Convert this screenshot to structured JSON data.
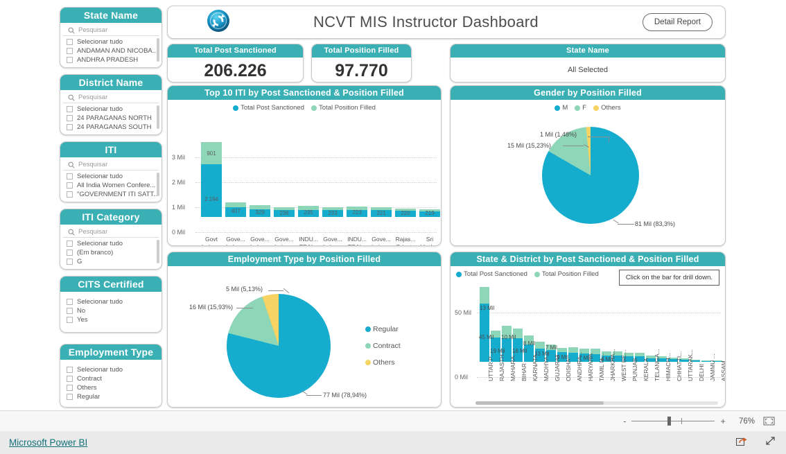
{
  "colors": {
    "teal_header": "#3aafb4",
    "series_sanctioned": "#16accd",
    "series_filled": "#8ed6b8",
    "others_yellow": "#f7d364",
    "link": "#10707a"
  },
  "header": {
    "logo_icon": "sync-circle-logo",
    "title": "NCVT MIS Instructor Dashboard",
    "detail_report_label": "Detail Report"
  },
  "kpis": [
    {
      "title": "Total Post Sanctioned",
      "value": "206.226"
    },
    {
      "title": "Total Position Filled",
      "value": "97.770"
    }
  ],
  "state_card": {
    "title": "State Name",
    "value": "All Selected"
  },
  "slicers": [
    {
      "title": "State Name",
      "search_placeholder": "Pesquisar",
      "options": [
        "Selecionar tudo",
        "ANDAMAN AND NICOBA...",
        "ANDHRA PRADESH"
      ],
      "has_search": true,
      "has_scrollbar": true
    },
    {
      "title": "District Name",
      "search_placeholder": "Pesquisar",
      "options": [
        "Selecionar tudo",
        "24 PARAGANAS NORTH",
        "24 PARAGANAS SOUTH"
      ],
      "has_search": true,
      "has_scrollbar": true
    },
    {
      "title": "ITI",
      "search_placeholder": "Pesquisar",
      "options": [
        "Selecionar tudo",
        "All India Women Confere...",
        "\"GOVERNMENT ITI SATT..."
      ],
      "has_search": true,
      "has_scrollbar": true
    },
    {
      "title": "ITI Category",
      "search_placeholder": "Pesquisar",
      "options": [
        "Selecionar tudo",
        "(Em branco)",
        "G"
      ],
      "has_search": true,
      "has_scrollbar": true
    },
    {
      "title": "CITS Certified",
      "search_placeholder": "",
      "options": [
        "Selecionar tudo",
        "No",
        "Yes"
      ],
      "has_search": false,
      "has_scrollbar": false
    },
    {
      "title": "Employment Type",
      "search_placeholder": "",
      "options": [
        "Selecionar tudo",
        "Contract",
        "Others",
        "Regular"
      ],
      "has_search": false,
      "has_scrollbar": false
    }
  ],
  "visuals": {
    "top10": {
      "title": "Top 10 ITI by Post Sanctioned & Position Filled"
    },
    "gender": {
      "title": "Gender by Position Filled"
    },
    "employment": {
      "title": "Employment Type by Position Filled"
    },
    "state_district": {
      "title": "State & District by Post Sanctioned & Position Filled",
      "drill_note": "Click on the bar for drill down."
    }
  },
  "statusbar": {
    "minus": "-",
    "plus": "+",
    "zoom_level": "76%",
    "fit_icon": "fit-to-page-icon"
  },
  "footer": {
    "link_label": "Microsoft Power BI",
    "share_icon": "share-icon",
    "fullscreen_icon": "fullscreen-icon"
  },
  "chart_data": [
    {
      "id": "top10",
      "type": "bar",
      "stacked": true,
      "title": "Top 10 ITI by Post Sanctioned & Position Filled",
      "xlabel": "",
      "ylabel": "",
      "ylim": [
        0,
        3000000
      ],
      "ytick_labels": [
        "0 Mil",
        "1 Mil",
        "2 Mil",
        "3 Mil"
      ],
      "grid": true,
      "legend_position": "top",
      "legend": [
        "Total Post Sanctioned",
        "Total Position Filled"
      ],
      "categories": [
        "Govt Indus... Traini...",
        "Gove... Indus... Traini...",
        "Gove... Indus... Traini...",
        "Gove... Indus... Traini...",
        "INDU... TRAI... INSTI...",
        "Gove... Indus... Traini...",
        "INDU... TRAI... INSTI...",
        "Gove... Indus... Traini...",
        "Rajas... Private Indus...",
        "Sri Venk... Indus..."
      ],
      "series": [
        {
          "name": "Total Post Sanctioned",
          "values": [
            2194,
            407,
            329,
            236,
            235,
            233,
            223,
            221,
            220,
            219
          ]
        },
        {
          "name": "Total Position Filled",
          "values": [
            901,
            150,
            110,
            85,
            130,
            80,
            90,
            80,
            55,
            48
          ]
        }
      ],
      "bar_data_labels": [
        "2.194",
        "407",
        "329",
        "236",
        "235",
        "233",
        "223",
        "221",
        "220",
        "219"
      ],
      "top_segment_label": "901"
    },
    {
      "id": "gender",
      "type": "pie",
      "title": "Gender by Position Filled",
      "legend_position": "top",
      "labels": [
        "M",
        "F",
        "Others"
      ],
      "values": [
        83.3,
        15.23,
        1.48
      ],
      "slice_labels": [
        "81 Mil (83,3%)",
        "15 Mil (15,23%)",
        "1 Mil (1,48%)"
      ],
      "slice_colors": [
        "#16accd",
        "#8ed6b8",
        "#f7d364"
      ]
    },
    {
      "id": "employment",
      "type": "pie",
      "title": "Employment Type by Position Filled",
      "legend_position": "right",
      "labels": [
        "Regular",
        "Contract",
        "Others"
      ],
      "values": [
        78.94,
        15.93,
        5.13
      ],
      "slice_labels": [
        "77 Mil (78,94%)",
        "16 Mil (15,93%)",
        "5 Mil (5,13%)"
      ],
      "slice_colors": [
        "#16accd",
        "#8ed6b8",
        "#f7d364"
      ]
    },
    {
      "id": "state_district",
      "type": "bar",
      "stacked": true,
      "title": "State & District by Post Sanctioned & Position Filled",
      "ylim": [
        0,
        60
      ],
      "ytick_labels": [
        "0 Mil",
        "50 Mil"
      ],
      "grid": true,
      "legend_position": "top",
      "legend": [
        "Total Post Sanctioned",
        "Total Position Filled"
      ],
      "categories": [
        "UTTAR P...",
        "RAJASTH...",
        "MAHARA...",
        "BIHAR",
        "KARNATA...",
        "MADHYA...",
        "GUJARAT",
        "ODISHA",
        "ANDHRA...",
        "HARYANA",
        "TAMIL N...",
        "JHARKHA...",
        "WEST BE...",
        "PUNJAB",
        "KERALA",
        "TELANGA...",
        "HIMACH...",
        "CHHATTI...",
        "UTTARAK...",
        "DELHI",
        "JAMMU ...",
        "ASSAM"
      ],
      "series": [
        {
          "name": "Total Post Sanctioned",
          "values": [
            45,
            19,
            18,
            18,
            13,
            10,
            9,
            7,
            7,
            6,
            6,
            5,
            5,
            4,
            4,
            3,
            2.5,
            2,
            1.5,
            1,
            0.6,
            0.5
          ]
        },
        {
          "name": "Total Position Filled",
          "values": [
            13,
            5,
            10,
            8,
            7,
            5,
            4,
            3,
            4,
            4,
            4,
            3,
            3,
            3,
            3,
            2,
            1.5,
            1.2,
            1,
            0.6,
            0.4,
            0.4
          ]
        }
      ],
      "visible_data_labels": [
        "13 Mil",
        "45 Mil",
        "19 Mil",
        "10 Mil",
        "18 Mil",
        "8 Mil",
        "13 Mil",
        "7 Mil",
        "9 Mil",
        "7 Mil",
        "6 Mil"
      ]
    }
  ]
}
